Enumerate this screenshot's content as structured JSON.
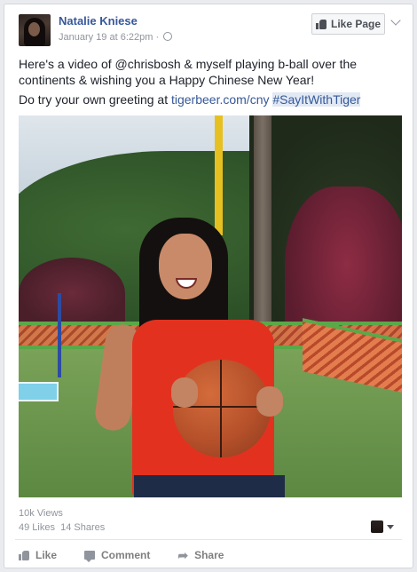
{
  "post": {
    "author": "Natalie Kniese",
    "timestamp": "January 19 at 6:22pm",
    "separator": "·",
    "text_line1": "Here's a video of @chrisbosh & myself playing b-ball over the continents & wishing you a Happy Chinese New Year!",
    "text_line2_prefix": "Do try your own greeting at ",
    "link": "tigerbeer.com/cny",
    "link_hashtag_gap": " ",
    "hashtag": "#SayItWithTiger"
  },
  "header": {
    "like_page_label": "Like Page"
  },
  "stats": {
    "views": "10k Views",
    "likes": "49 Likes",
    "shares": "14 Shares"
  },
  "actions": {
    "like": "Like",
    "comment": "Comment",
    "share": "Share"
  },
  "icons": {
    "privacy": "globe-icon",
    "like_page": "thumbs-up-icon",
    "menu": "chevron-down-icon",
    "comment": "comment-icon",
    "share": "share-arrow-icon"
  },
  "colors": {
    "link": "#365899",
    "hashtag_bg": "#e1e9f4",
    "text": "#1d2129",
    "meta": "#90949c"
  }
}
